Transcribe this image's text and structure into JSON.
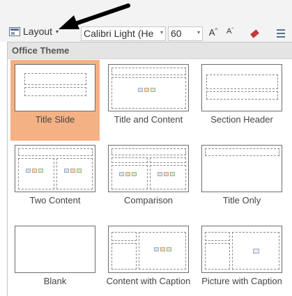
{
  "ribbon": {
    "layout_button": {
      "label": "Layout",
      "caret": "▾"
    },
    "font_name": {
      "value": "Calibri Light (He",
      "caret": "▾"
    },
    "font_size": {
      "value": "60",
      "caret": "▾"
    },
    "grow_font": {
      "label": "A"
    },
    "shrink_font": {
      "label": "A"
    }
  },
  "dropdown": {
    "group_title": "Office Theme",
    "selected_index": 0,
    "layouts": [
      {
        "label": "Title Slide",
        "icon": "title-slide-layout"
      },
      {
        "label": "Title and Content",
        "icon": "title-and-content-layout"
      },
      {
        "label": "Section Header",
        "icon": "section-header-layout"
      },
      {
        "label": "Two Content",
        "icon": "two-content-layout"
      },
      {
        "label": "Comparison",
        "icon": "comparison-layout"
      },
      {
        "label": "Title Only",
        "icon": "title-only-layout"
      },
      {
        "label": "Blank",
        "icon": "blank-layout"
      },
      {
        "label": "Content with Caption",
        "icon": "content-with-caption-layout"
      },
      {
        "label": "Picture with Caption",
        "icon": "picture-with-caption-layout"
      }
    ]
  },
  "colors": {
    "selection": "#f4b183",
    "header_bg": "#e4e4e4",
    "ribbon_bg": "#f3f3f3",
    "arrow": "#000000"
  }
}
